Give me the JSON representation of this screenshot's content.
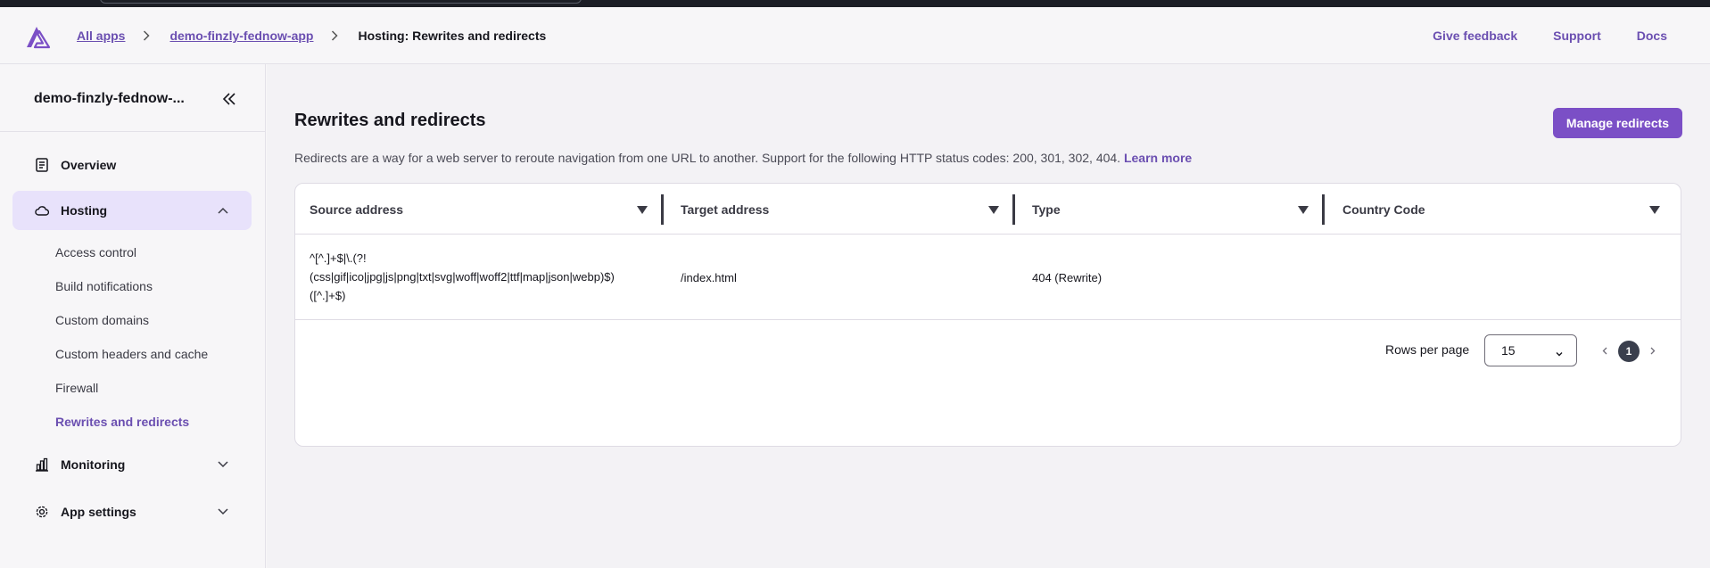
{
  "breadcrumb": {
    "all_apps": "All apps",
    "app": "demo-finzly-fednow-app",
    "current": "Hosting: Rewrites and redirects"
  },
  "header_links": {
    "feedback": "Give feedback",
    "support": "Support",
    "docs": "Docs"
  },
  "sidebar": {
    "title": "demo-finzly-fednow-...",
    "overview": "Overview",
    "hosting": "Hosting",
    "hosting_items": [
      "Access control",
      "Build notifications",
      "Custom domains",
      "Custom headers and cache",
      "Firewall",
      "Rewrites and redirects"
    ],
    "monitoring": "Monitoring",
    "app_settings": "App settings"
  },
  "main": {
    "heading": "Rewrites and redirects",
    "manage_button": "Manage redirects",
    "description": "Redirects are a way for a web server to reroute navigation from one URL to another. Support for the following HTTP status codes: 200, 301, 302, 404.",
    "learn_more": "Learn more"
  },
  "table": {
    "columns": [
      "Source address",
      "Target address",
      "Type",
      "Country Code"
    ],
    "rows": [
      {
        "source_lines": [
          "^[^.]+$|\\.(?!",
          "(css|gif|ico|jpg|js|png|txt|svg|woff|woff2|ttf|map|json|webp)$)",
          "([^.]+$)"
        ],
        "target": "/index.html",
        "type": "404 (Rewrite)",
        "country": ""
      }
    ]
  },
  "pagination": {
    "rows_per_page_label": "Rows per page",
    "rows_per_page_value": "15",
    "current_page": "1"
  },
  "colors": {
    "accent": "#7b4fc6",
    "link": "#6b4fb1",
    "active_nav_bg": "#e8e2fb"
  }
}
